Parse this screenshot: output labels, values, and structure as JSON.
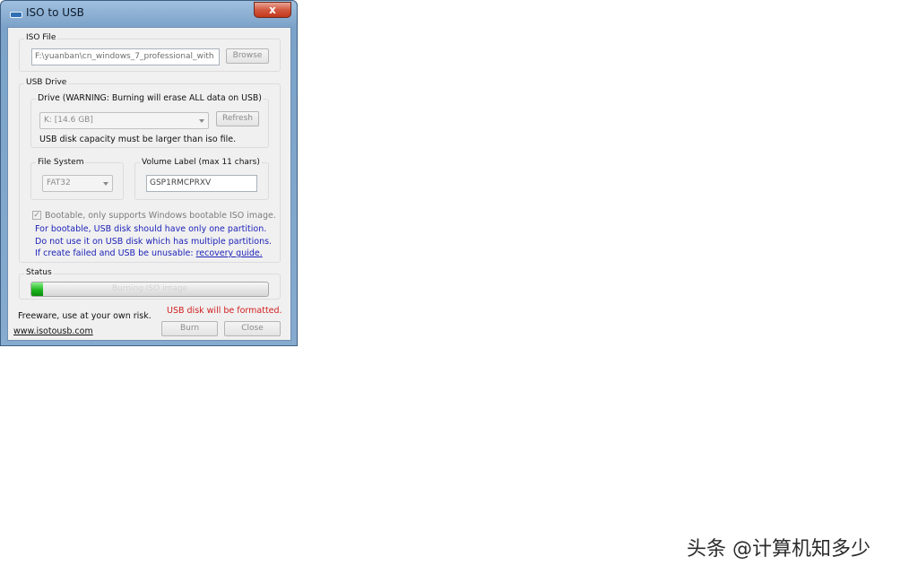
{
  "window": {
    "title": "ISO to USB",
    "close_glyph": "x"
  },
  "iso_file": {
    "legend": "ISO File",
    "path_value": "F:\\yuanban\\cn_windows_7_professional_with",
    "browse_label": "Browse"
  },
  "usb_drive": {
    "legend": "USB Drive",
    "drive_legend": "Drive (WARNING: Burning will erase ALL data on USB)",
    "drive_selected": "K: [14.6 GB]",
    "refresh_label": "Refresh",
    "capacity_note": "USB disk capacity must be larger than iso file.",
    "filesystem_legend": "File System",
    "filesystem_selected": "FAT32",
    "volume_legend": "Volume Label (max 11 chars)",
    "volume_value": "GSP1RMCPRXV",
    "bootable_label": "Bootable, only supports Windows bootable ISO image.",
    "bootable_checked": true,
    "note_line1": "For bootable, USB disk should have only one partition.",
    "note_line2": "Do not use it on USB disk which has multiple partitions.",
    "note_line3": "If create failed and USB be unusable:",
    "recovery_link": "recovery guide."
  },
  "status": {
    "legend": "Status",
    "progress_text": "Burning ISO image",
    "progress_fraction": 0.05
  },
  "footer": {
    "freeware_text": "Freeware, use at your own risk.",
    "warning_text": "USB disk will be formatted.",
    "website_link": "www.isotousb.com",
    "burn_label": "Burn",
    "close_label": "Close"
  },
  "watermark": {
    "text": "头条 @计算机知多少"
  },
  "colors": {
    "note_blue": "#1e23b8",
    "warning_red": "#d21f1f",
    "progress_green": "#1fb51f"
  }
}
